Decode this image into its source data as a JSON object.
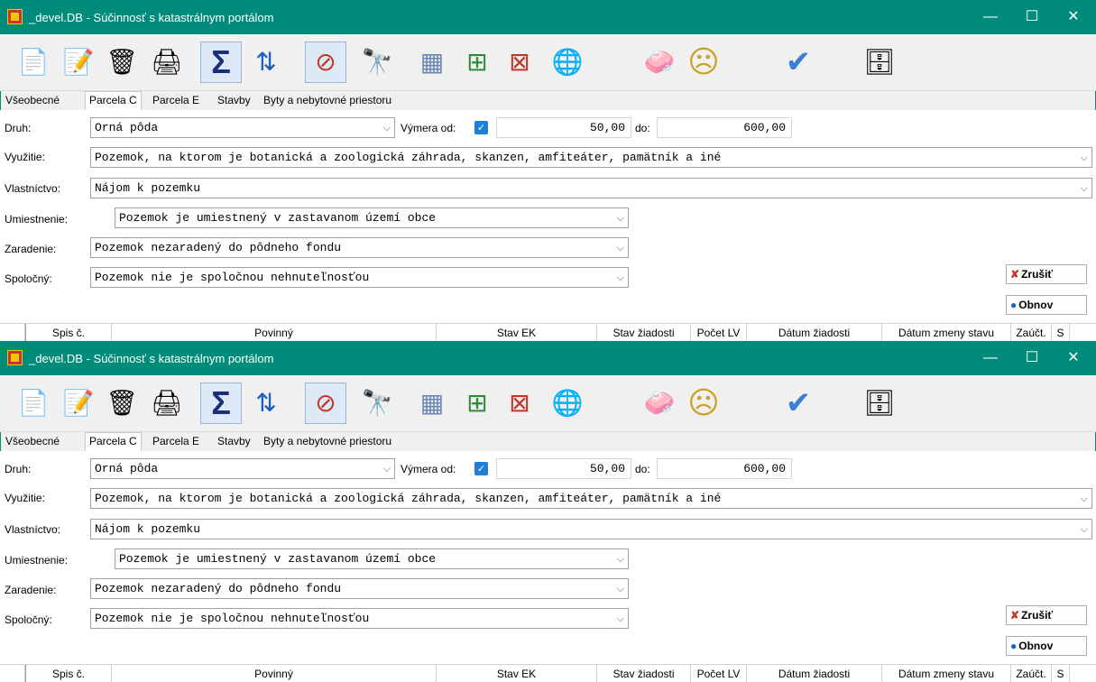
{
  "window": {
    "title": "_devel.DB - Súčinnosť s katastrálnym portálom",
    "minimize_icon": "—",
    "maximize_icon": "☐",
    "close_icon": "✕"
  },
  "toolbar": [
    {
      "name": "new-doc-icon",
      "glyph": "📄"
    },
    {
      "name": "edit-doc-icon",
      "glyph": "📝"
    },
    {
      "name": "delete-doc-icon",
      "glyph": "🗑"
    },
    {
      "name": "print-icon",
      "glyph": "🖨"
    },
    {
      "name": "sum-icon",
      "glyph": "Σ"
    },
    {
      "name": "sort-az-icon",
      "glyph": "⇅"
    },
    {
      "name": "clear-filter-icon",
      "glyph": "⊘"
    },
    {
      "name": "binoculars-icon",
      "glyph": "🔭"
    },
    {
      "name": "grid-icon",
      "glyph": "▦"
    },
    {
      "name": "add-row-icon",
      "glyph": "⊞"
    },
    {
      "name": "delete-row-icon",
      "glyph": "⊠"
    },
    {
      "name": "refresh-globe-icon",
      "glyph": "🌐"
    },
    {
      "name": "soap-icon",
      "glyph": "🧼"
    },
    {
      "name": "sad-face-icon",
      "glyph": "☹"
    },
    {
      "name": "check-icon",
      "glyph": "✔"
    },
    {
      "name": "database-icon",
      "glyph": "🗄"
    }
  ],
  "tabs": [
    "Všeobecné",
    "Parcela C",
    "Parcela E",
    "Stavby",
    "Byty a nebytovné priestoru"
  ],
  "form": {
    "druh_label": "Druh:",
    "druh_value": "Orná pôda",
    "vymera_od_label": "Výmera od:",
    "vymera_checked": "✓",
    "vymera_od_value": "50,00",
    "do_label": "do:",
    "vymera_do_value": "600,00",
    "vyuzitie_label": "Využitie:",
    "vyuzitie_value": "Pozemok, na ktorom je botanická a zoologická záhrada, skanzen, amfiteáter, pamätník a iné",
    "vlastnictvo_label": "Vlastníctvo:",
    "vlastnictvo_value": "Nájom k pozemku",
    "umiestnenie_label": "Umiestnenie:",
    "umiestnenie_value": "Pozemok je umiestnený v zastavanom území obce",
    "zaradenie_label": "Zaradenie:",
    "zaradenie_value": "Pozemok nezaradený do pôdneho fondu",
    "spolocny_label": "Spoločný:",
    "spolocny_value": "Pozemok nie je spoločnou nehnuteľnosťou",
    "chevron": "⌵"
  },
  "buttons": {
    "zrusit": "Zrušiť",
    "obnov": "Obnov"
  },
  "grid_columns": [
    "Spis č.",
    "Povinný",
    "Stav EK",
    "Stav žiadosti",
    "Počet LV",
    "Dátum žiadosti",
    "Dátum zmeny stavu",
    "Zaúčt.",
    "S"
  ]
}
